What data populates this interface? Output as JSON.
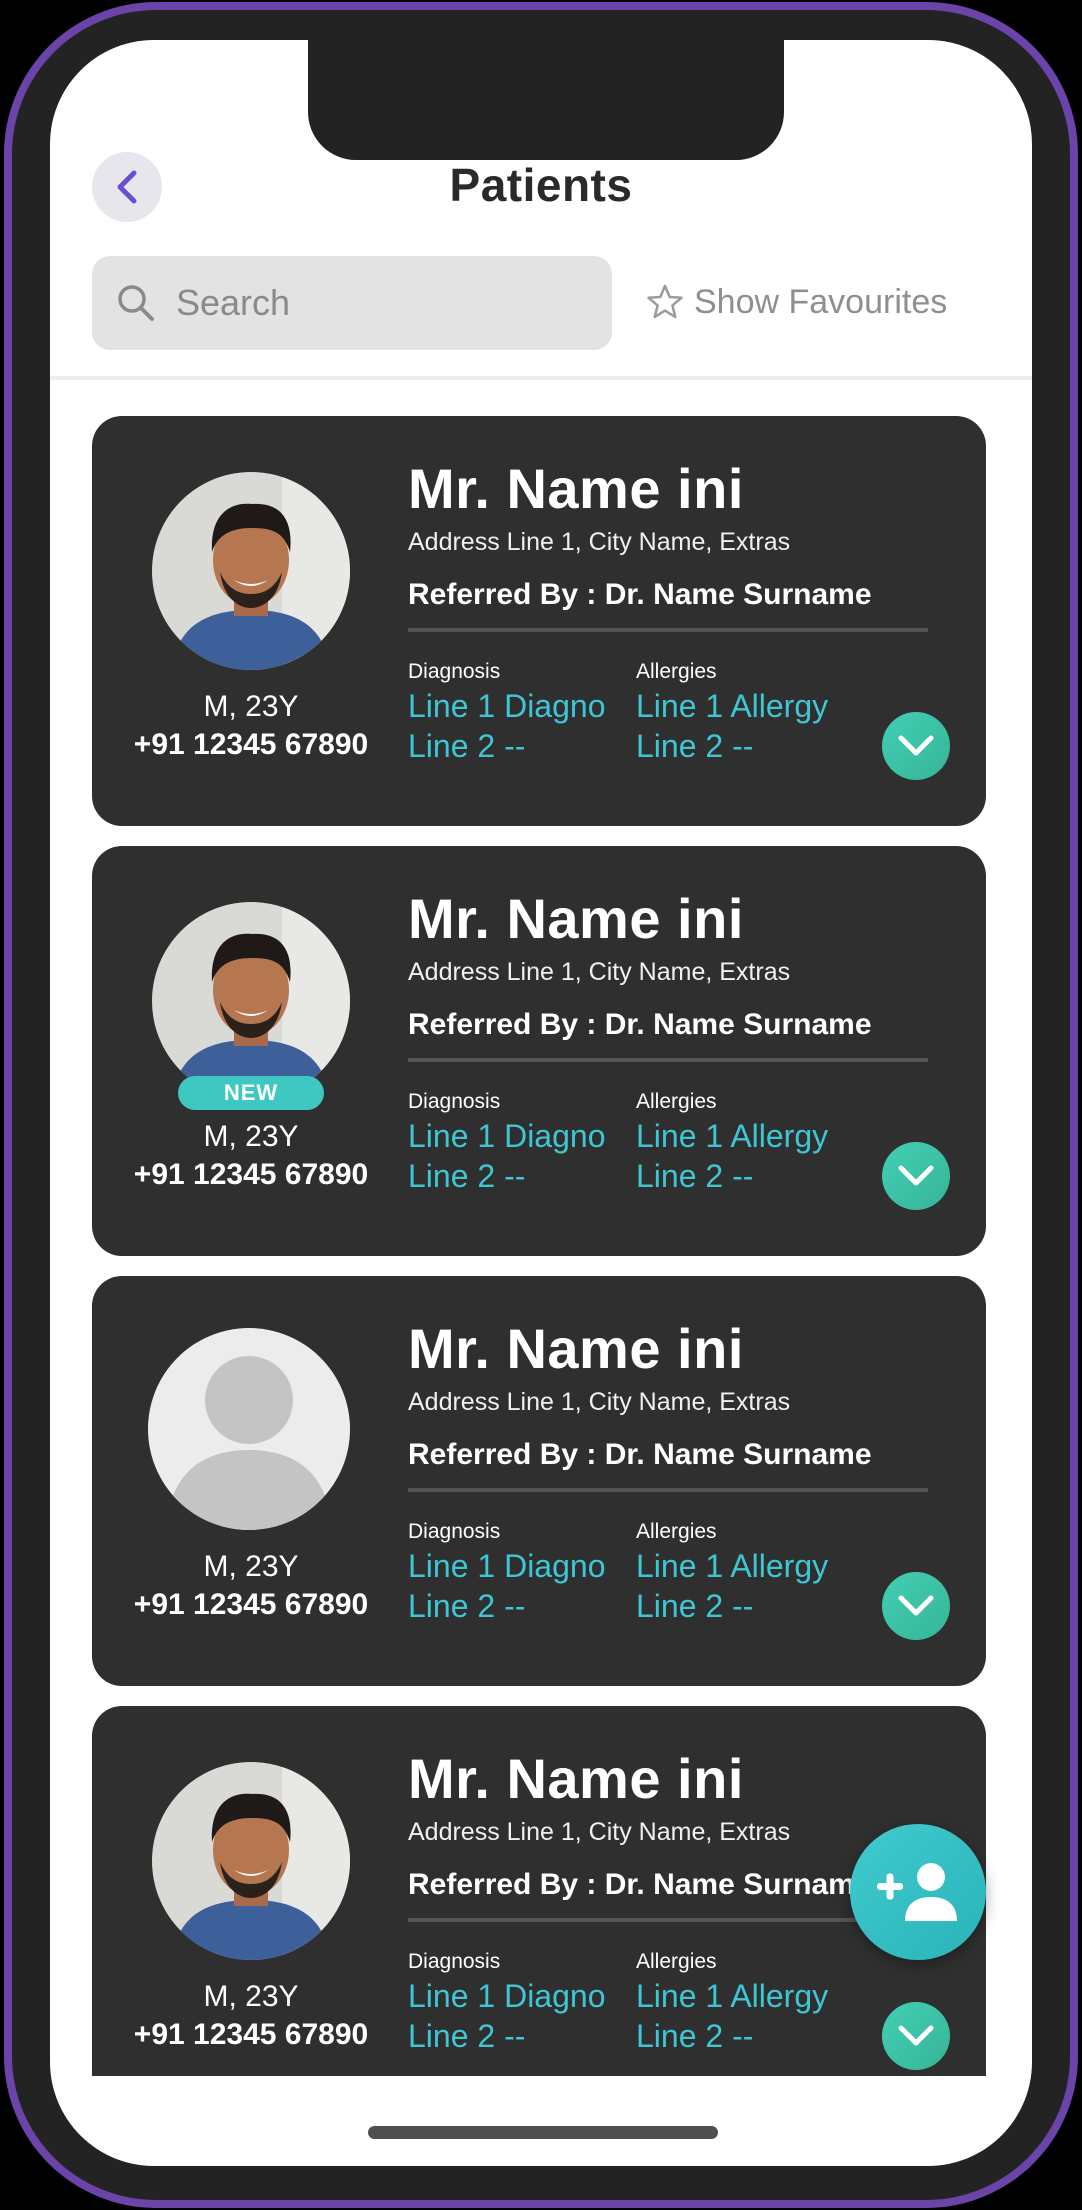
{
  "header": {
    "title": "Patients",
    "back_icon": "chevron-left-icon"
  },
  "search": {
    "placeholder": "Search",
    "value": ""
  },
  "favourites": {
    "label": "Show Favourites",
    "icon": "star-outline-icon",
    "active": false
  },
  "labels": {
    "diagnosis": "Diagnosis",
    "allergies": "Allergies"
  },
  "patients": [
    {
      "name": "Mr. Name ini",
      "address": "Address Line 1, City Name, Extras",
      "referred_by": "Referred By : Dr. Name Surname",
      "gender_age": "M, 23Y",
      "phone": "+91 12345 67890",
      "diagnosis": [
        "Line 1 Diagno",
        "Line 2 --"
      ],
      "allergies": [
        "Line 1 Allergy",
        "Line 2 --"
      ],
      "avatar": "photo",
      "badge": ""
    },
    {
      "name": "Mr. Name ini",
      "address": "Address Line 1, City Name, Extras",
      "referred_by": "Referred By : Dr. Name Surname",
      "gender_age": "M, 23Y",
      "phone": "+91 12345 67890",
      "diagnosis": [
        "Line 1 Diagno",
        "Line 2 --"
      ],
      "allergies": [
        "Line 1 Allergy",
        "Line 2 --"
      ],
      "avatar": "photo",
      "badge": "NEW"
    },
    {
      "name": "Mr. Name ini",
      "address": "Address Line 1, City Name, Extras",
      "referred_by": "Referred By : Dr. Name Surname",
      "gender_age": "M, 23Y",
      "phone": "+91 12345 67890",
      "diagnosis": [
        "Line 1 Diagno",
        "Line 2 --"
      ],
      "allergies": [
        "Line 1 Allergy",
        "Line 2 --"
      ],
      "avatar": "placeholder",
      "badge": ""
    },
    {
      "name": "Mr. Name ini",
      "address": "Address Line 1, City Name, Extras",
      "referred_by": "Referred By : Dr. Name Surname",
      "gender_age": "M, 23Y",
      "phone": "+91 12345 67890",
      "diagnosis": [
        "Line 1 Diagno",
        "Line 2 --"
      ],
      "allergies": [
        "Line 1 Allergy",
        "Line 2 --"
      ],
      "avatar": "photo",
      "badge": ""
    }
  ],
  "fab": {
    "icon": "add-user-icon"
  },
  "colors": {
    "accent": "#3ec6d4",
    "card": "#2f2f2f",
    "expand": "#3cc2a6",
    "badge": "#3fc8c2",
    "frame": "#6a44a8"
  }
}
